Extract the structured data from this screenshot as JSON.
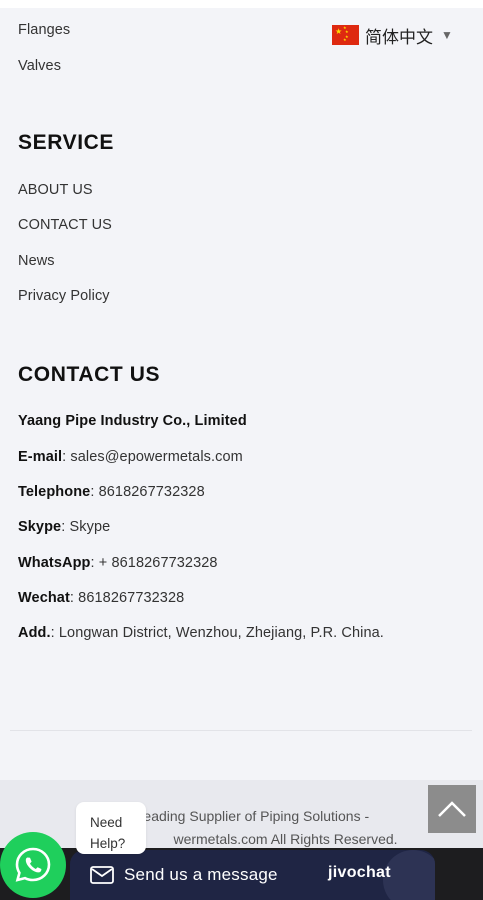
{
  "products": {
    "links": [
      "Flanges",
      "Valves"
    ]
  },
  "language": {
    "label": "简体中文",
    "flag": "china-flag-icon"
  },
  "service": {
    "heading": "SERVICE",
    "links": [
      "ABOUT US",
      "CONTACT US",
      "News",
      "Privacy Policy"
    ]
  },
  "contact": {
    "heading": "CONTACT US",
    "company": "Yaang Pipe Industry Co., Limited",
    "rows": [
      {
        "label": "E-mail",
        "value": ": sales@epowermetals.com"
      },
      {
        "label": "Telephone",
        "value": ": 8618267732328"
      },
      {
        "label": "Skype",
        "value": ": Skype"
      },
      {
        "label": "WhatsApp",
        "value": ": + 8618267732328"
      },
      {
        "label": "Wechat",
        "value": ": 8618267732328"
      },
      {
        "label": "Add.",
        "value": ": Longwan District, Wenzhou, Zhejiang, P.R. China."
      }
    ]
  },
  "footer": {
    "copyright_line1": "Co Leading Supplier of Piping Solutions -",
    "copyright_line2": "wermetals.com All Rights Reserved."
  },
  "chat": {
    "need_help_line1": "Need",
    "need_help_line2": "Help?",
    "send_label": "Send us a message",
    "brand": "jivochat",
    "accent": "#1f2544",
    "whatsapp_color": "#1fcf5c"
  },
  "icons": {
    "back_to_top": "chevron-up-icon",
    "whatsapp": "whatsapp-icon",
    "mail": "mail-icon"
  }
}
